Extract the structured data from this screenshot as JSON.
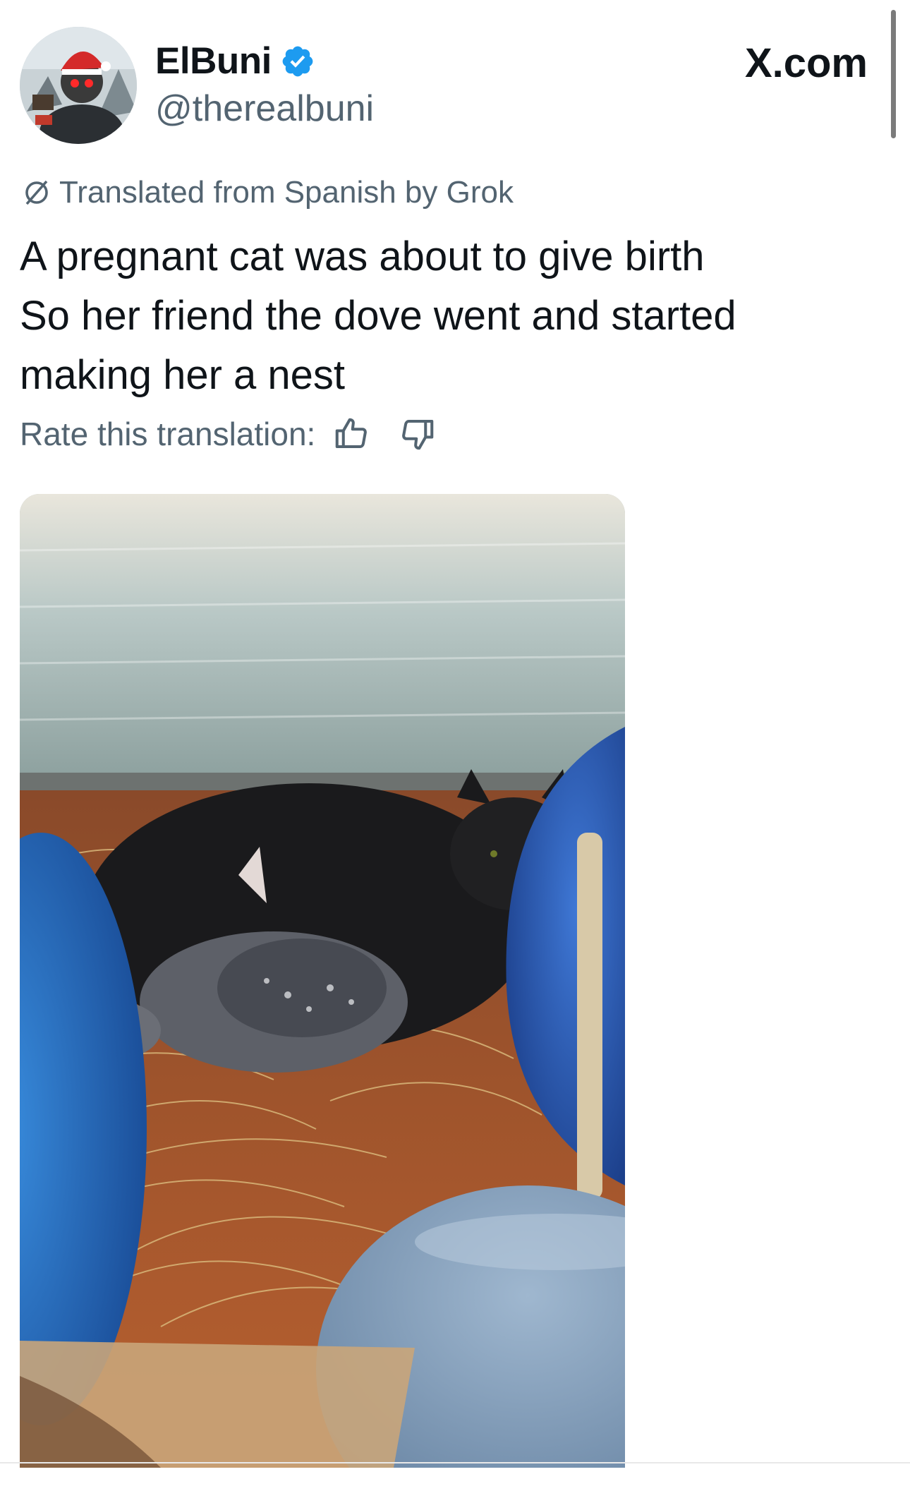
{
  "header": {
    "display_name": "ElBuni",
    "handle": "@therealbuni",
    "verified_icon": "verified-badge-icon",
    "brand": "X.com"
  },
  "translation": {
    "notice": "Translated from Spanish by Grok",
    "icon": "translate-slash-icon",
    "rate_label": "Rate this translation:",
    "thumbs_up_icon": "thumbs-up-icon",
    "thumbs_down_icon": "thumbs-down-icon"
  },
  "tweet": {
    "lines": [
      "A pregnant cat was about to give birth",
      "So her friend the dove went and started",
      "making her a nest"
    ]
  },
  "colors": {
    "text_primary": "#0f1419",
    "text_secondary": "#536471",
    "verified_blue": "#1d9bf0",
    "background": "#ffffff"
  }
}
